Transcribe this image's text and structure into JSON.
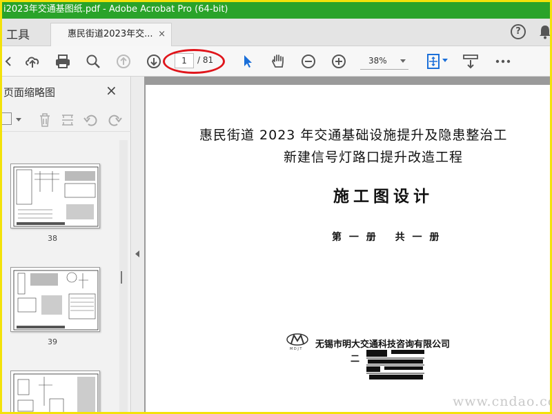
{
  "window": {
    "title": "i2023年交通基图纸.pdf - Adobe Acrobat Pro (64-bit)"
  },
  "tabbar": {
    "tools_label": "工具",
    "tab_label": "惠民街道2023年交...",
    "tab_close": "×"
  },
  "toolbar": {
    "page_current": "1",
    "page_total": "/ 81",
    "zoom": "38%",
    "icons": [
      "undo-icon",
      "upload-icon",
      "print-icon",
      "zoom-icon",
      "page-up-icon",
      "page-down-icon",
      "select-icon",
      "hand-icon",
      "zoom-out-icon",
      "zoom-in-icon",
      "fit-page-icon",
      "scroll-icon",
      "more-icon"
    ]
  },
  "left_panel": {
    "title": "页面缩略图",
    "close": "×",
    "thumbnails": [
      {
        "label": "38"
      },
      {
        "label": "39"
      }
    ]
  },
  "document": {
    "title_line1": "惠民街道 2023 年交通基础设施提升及隐患整治工",
    "title_line2": "新建信号灯路口提升改造工程",
    "design": "施工图设计",
    "volume": "第 一 册　 共 一 册",
    "company": "无锡市明大交通科技咨询有限公司",
    "date_prefix": "二"
  },
  "watermark": "www.cndao.com",
  "colors": {
    "title_bar": "#2aa32a",
    "frame": "#f3e20a",
    "annotation_ellipse": "#e0151b",
    "select_icon": "#1a6fd9"
  }
}
